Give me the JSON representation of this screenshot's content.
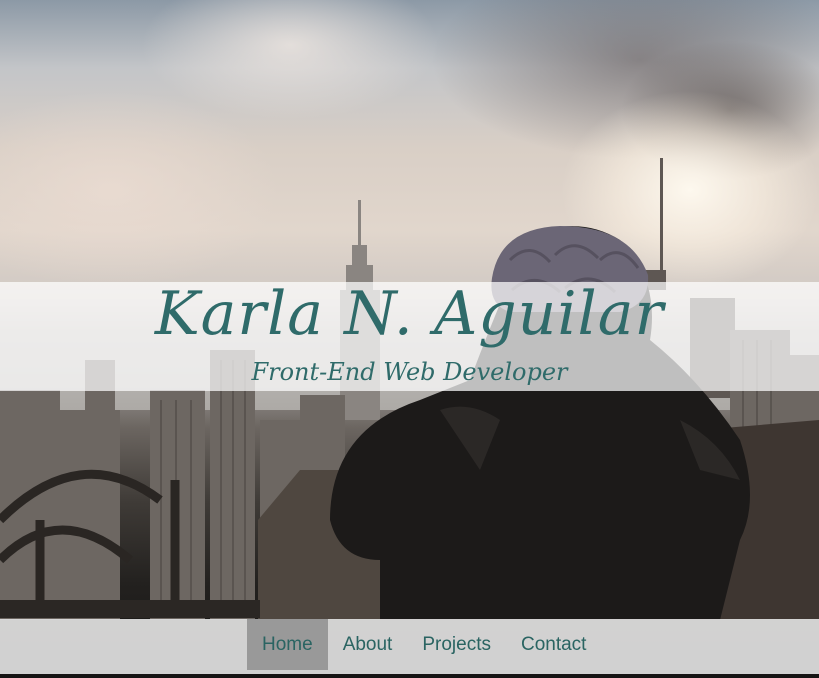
{
  "header": {
    "name": "Karla N. Aguilar",
    "tagline": "Front-End Web Developer"
  },
  "nav": {
    "items": [
      "Home",
      "About",
      "Projects",
      "Contact"
    ],
    "active": "Home"
  },
  "colors": {
    "accent": "#2f6b6a",
    "nav_background": "#e0e0e0",
    "nav_active": "#999999"
  }
}
